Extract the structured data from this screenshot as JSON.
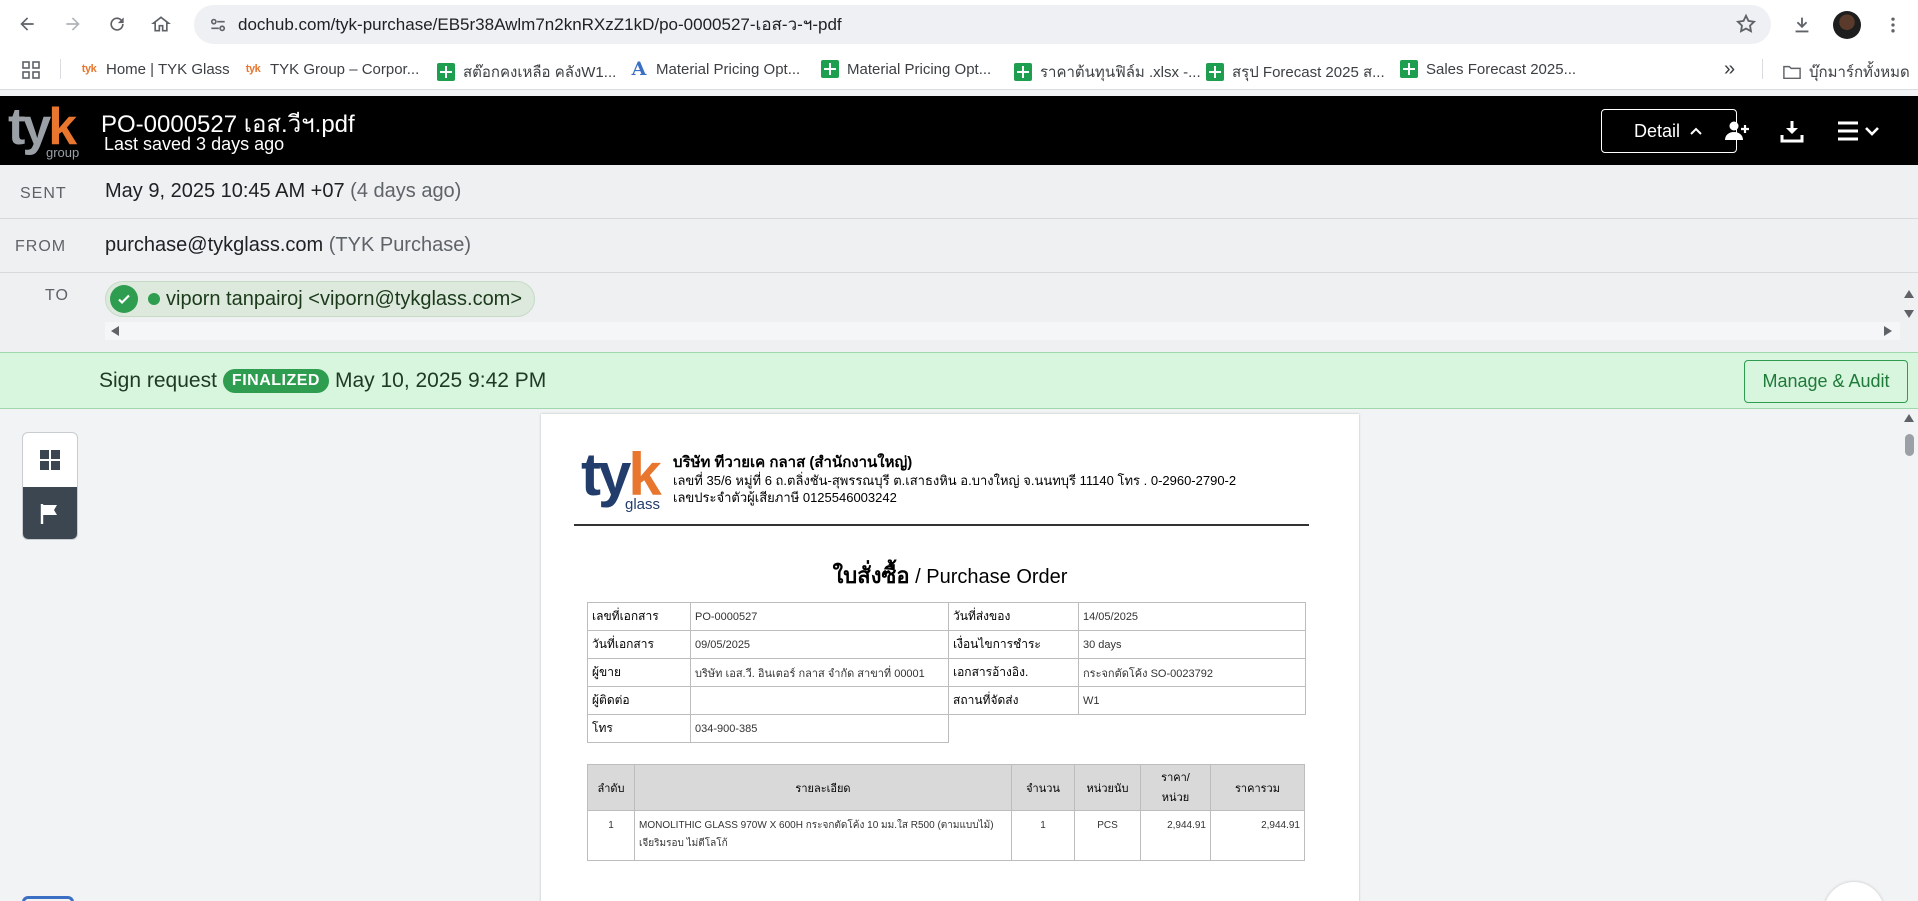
{
  "browser": {
    "url": "dochub.com/tyk-purchase/EB5r38Awlm7n2knRXzZ1kD/po-0000527-เอส-ว-ฯ-pdf",
    "bookmarks": [
      {
        "label": "Home | TYK Glass",
        "icon": "tyk"
      },
      {
        "label": "TYK Group – Corpor...",
        "icon": "tyk"
      },
      {
        "label": "สต๊อกคงเหลือ คลังW1...",
        "icon": "sheets"
      },
      {
        "label": "Material Pricing Opt...",
        "icon": "letter-a"
      },
      {
        "label": "Material Pricing Opt...",
        "icon": "sheets"
      },
      {
        "label": "ราคาต้นทุนฟิล์ม .xlsx -...",
        "icon": "sheets"
      },
      {
        "label": "สรุป Forecast 2025 ส...",
        "icon": "sheets"
      },
      {
        "label": "Sales Forecast 2025...",
        "icon": "sheets"
      }
    ],
    "more_bookmarks": "»",
    "all_bookmarks": "บุ๊กมาร์กทั้งหมด"
  },
  "app": {
    "logo_main": "ty",
    "logo_accent": "k",
    "logo_sub": "group",
    "title": "PO-0000527 เอส.วีฯ.pdf",
    "saved": "Last saved 3 days ago",
    "detail_button": "Detail"
  },
  "email": {
    "sent_label": "SENT",
    "sent_value": "May 9, 2025 10:45 AM +07",
    "sent_relative": "(4 days ago)",
    "from_label": "FROM",
    "from_email": "purchase@tykglass.com",
    "from_name": "(TYK Purchase)",
    "to_label": "TO",
    "to_recipient": "viporn tanpairoj <viporn@tykglass.com>"
  },
  "sign_request": {
    "label": "Sign request",
    "status": "FINALIZED",
    "date": "May 10, 2025 9:42 PM",
    "manage_button": "Manage & Audit"
  },
  "document": {
    "logo_main": "ty",
    "logo_accent": "k",
    "logo_sub": "glass",
    "company_name": "บริษัท ทีวายเค กลาส (สำนักงานใหญ่)",
    "company_address": "เลขที่ 35/6 หมู่ที่ 6 ถ.ตลิ่งชัน-สุพรรณบุรี ต.เสาธงหิน  อ.บางใหญ่ จ.นนทบุรี  11140 โทร . 0-2960-2790-2",
    "company_tax": "เลขประจำตัวผู้เสียภาษี   0125546003242",
    "title_th": "ใบสั่งซื้อ",
    "title_en": " / Purchase Order",
    "info": {
      "doc_no_label": "เลขที่เอกสาร",
      "doc_no": "PO-0000527",
      "delivery_date_label": "วันที่ส่งของ",
      "delivery_date": "14/05/2025",
      "doc_date_label": "วันที่เอกสาร",
      "doc_date": "09/05/2025",
      "payment_label": "เงื่อนไขการชำระ",
      "payment": "30 days",
      "vendor_label": "ผู้ขาย",
      "vendor": "บริษัท เอส.วี. อินเตอร์ กลาส  จำกัด สาขาที่ 00001",
      "ref_label": "เอกสารอ้างอิง.",
      "ref": "กระจกตัดโค้ง SO-0023792",
      "contact_label": "ผู้ติดต่อ",
      "contact": "",
      "ship_to_label": "สถานที่จัดส่ง",
      "ship_to": "W1",
      "phone_label": "โทร",
      "phone": "034-900-385"
    },
    "items_headers": {
      "no": "ลำดับ",
      "desc": "รายละเอียด",
      "qty": "จำนวน",
      "unit": "หน่วยนับ",
      "price_line1": "ราคา/",
      "price_line2": "หน่วย",
      "total": "ราคารวม"
    },
    "items": [
      {
        "no": "1",
        "desc": "MONOLITHIC GLASS     970W X 600H   กระจกตัดโค้ง 10 มม.ใส  R500 (ตามแบบไม้) เจียริมรอบ ไม่ตีโลโก้",
        "qty": "1",
        "unit": "PCS",
        "price": "2,944.91",
        "total": "2,944.91"
      }
    ]
  },
  "colors": {
    "accent_green": "#2e9d4f",
    "sign_bar_bg": "#d8f5de",
    "header_bg": "#000000",
    "logo_orange": "#e8762e",
    "logo_navy": "#223d6b"
  }
}
